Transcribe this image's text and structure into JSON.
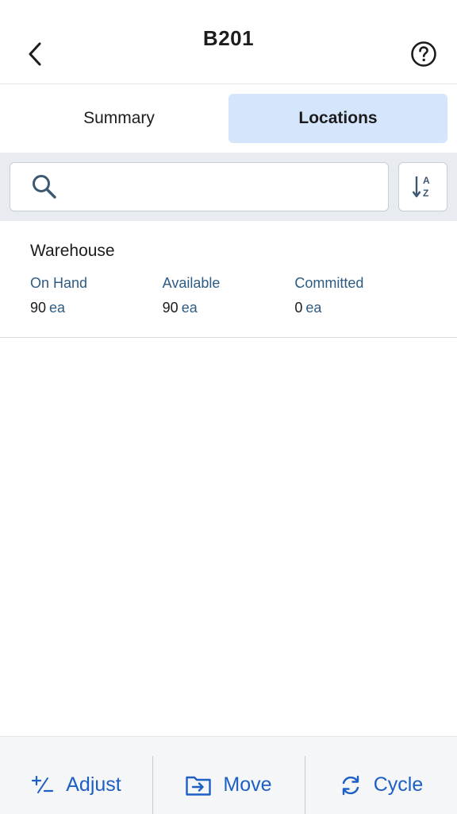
{
  "header": {
    "title": "B201",
    "back_icon": "chevron-left-icon",
    "help_icon": "help-circle-icon"
  },
  "tabs": [
    {
      "label": "Summary",
      "active": false
    },
    {
      "label": "Locations",
      "active": true
    }
  ],
  "search": {
    "placeholder": "",
    "value": "",
    "icon": "search-icon",
    "sort_icon": "sort-az-icon"
  },
  "locations": [
    {
      "name": "Warehouse",
      "on_hand_label": "On Hand",
      "on_hand_value": "90",
      "on_hand_unit": "ea",
      "available_label": "Available",
      "available_value": "90",
      "available_unit": "ea",
      "committed_label": "Committed",
      "committed_value": "0",
      "committed_unit": "ea"
    }
  ],
  "toolbar": {
    "adjust_label": "Adjust",
    "move_label": "Move",
    "cycle_label": "Cycle"
  },
  "colors": {
    "accent": "#1d5fc4",
    "active_tab_bg": "#d5e5fb",
    "label_blue": "#2e5b82"
  }
}
